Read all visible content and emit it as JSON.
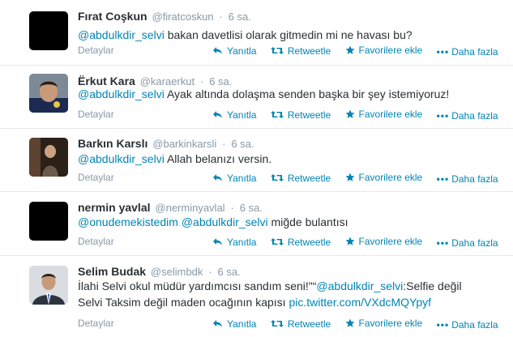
{
  "colors": {
    "link": "#0084b4",
    "meta": "#8899a6",
    "text": "#292f33"
  },
  "actions": {
    "reply": "Yanıtla",
    "retweet": "Retweetle",
    "favorite": "Favorilere ekle",
    "more": "Daha fazla",
    "details": "Detaylar"
  },
  "tweets": [
    {
      "fullname": "Fırat Coşkun",
      "username": "@firatcoskun",
      "dot": "·",
      "time": "6 sa.",
      "mention1": "@abdulkdir_selvi",
      "text": " bakan davetlisi olarak gitmedin mi ne havası bu?"
    },
    {
      "fullname": "Ërkut Kara",
      "username": "@karaerkut",
      "dot": "·",
      "time": "6 sa.",
      "mention1": "@abdulkdir_selvi",
      "text": " Ayak altında dolaşma senden başka bir şey istemiyoruz!"
    },
    {
      "fullname": "Barkın Karslı",
      "username": "@barkinkarsli",
      "dot": "·",
      "time": "6 sa.",
      "mention1": "@abdulkdir_selvi",
      "text": " Allah belanızı versin."
    },
    {
      "fullname": "nermin yavlal",
      "username": "@nerminyavlal",
      "dot": "·",
      "time": "6 sa.",
      "mention1": "@onudemekistedim",
      "mention2": "@abdulkdir_selvi",
      "text": " miğde bulantısı"
    },
    {
      "fullname": "Selim Budak",
      "username": "@selimbdk",
      "dot": "·",
      "time": "6 sa.",
      "text_start": "İlahi Selvi okul müdür yardımcısı sandım seni!\"“",
      "mention1": "@abdulkdir_selvi",
      "text_mid": ":Selfie değil",
      "text_line2": "Selvi Taksim değil maden ocağının kapısı ",
      "link": "pic.twitter.com/VXdcMQYpyf"
    }
  ]
}
